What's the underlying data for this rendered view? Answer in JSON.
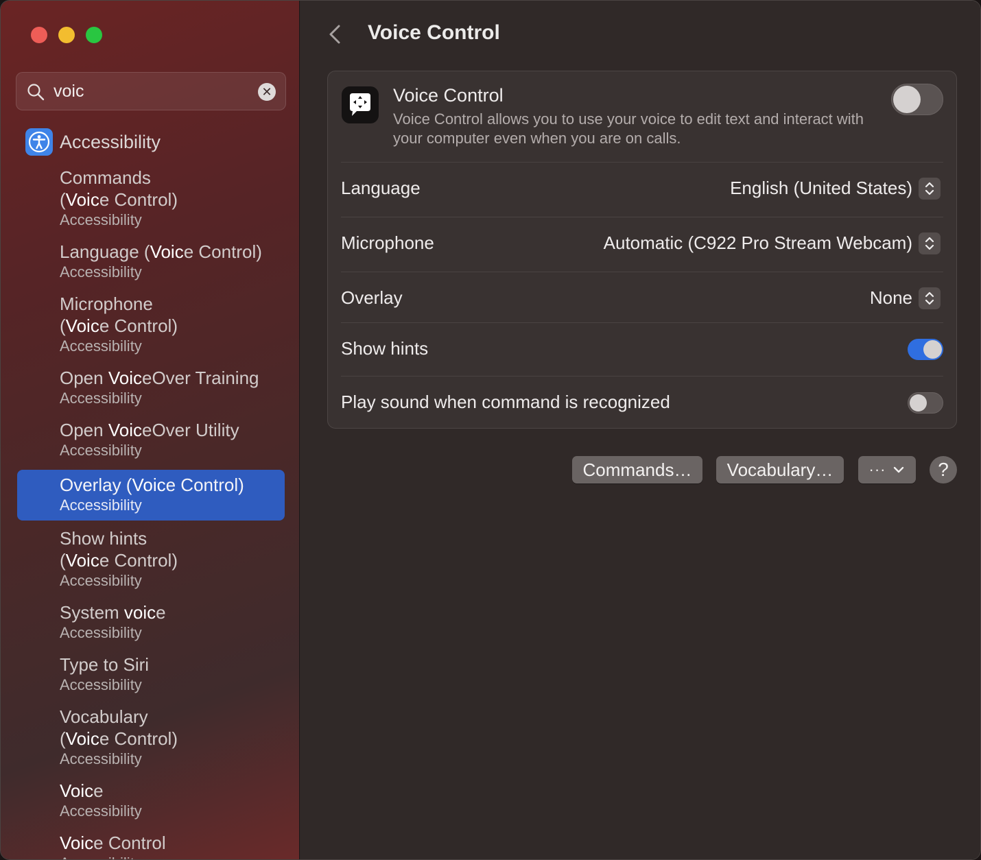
{
  "window": {
    "traffic_lights": {
      "close": "#ee5d57",
      "minimize": "#f3bd2f",
      "zoom": "#29c641"
    }
  },
  "sidebar": {
    "search": {
      "value": "voic",
      "icon": "magnifying-glass-icon",
      "clear_icon": "clear-x-icon"
    },
    "group": {
      "title": "Accessibility",
      "icon": "accessibility-icon",
      "icon_color": "#3f84e8"
    },
    "results": [
      {
        "pre": "Commands\n(",
        "hl": "Voic",
        "post": "e Control)",
        "sub": "Accessibility"
      },
      {
        "pre": "Language (",
        "hl": "Voic",
        "post": "e Control)",
        "sub": "Accessibility"
      },
      {
        "pre": "Microphone\n(",
        "hl": "Voic",
        "post": "e Control)",
        "sub": "Accessibility"
      },
      {
        "pre": "Open ",
        "hl": "Voic",
        "post": "eOver Training",
        "sub": "Accessibility"
      },
      {
        "pre": "Open ",
        "hl": "Voic",
        "post": "eOver Utility",
        "sub": "Accessibility"
      },
      {
        "pre": "Overlay (",
        "hl": "Voic",
        "post": "e Control)",
        "sub": "Accessibility",
        "selected": true
      },
      {
        "pre": "Show hints\n(",
        "hl": "Voic",
        "post": "e Control)",
        "sub": "Accessibility"
      },
      {
        "pre": "System ",
        "hl": "voic",
        "post": "e",
        "sub": "Accessibility"
      },
      {
        "pre": "Type to Siri",
        "hl": "",
        "post": "",
        "sub": "Accessibility"
      },
      {
        "pre": "Vocabulary\n(",
        "hl": "Voic",
        "post": "e Control)",
        "sub": "Accessibility"
      },
      {
        "pre": "",
        "hl": "Voic",
        "post": "e",
        "sub": "Accessibility"
      },
      {
        "pre": "",
        "hl": "Voic",
        "post": "e Control",
        "sub": "Accessibility"
      }
    ],
    "selected_color": "#2f5cbf"
  },
  "main": {
    "back_icon": "chevron-left-icon",
    "title": "Voice Control",
    "voice_control": {
      "icon": "voice-control-icon",
      "title": "Voice Control",
      "description": "Voice Control allows you to use your voice to edit text and interact with your computer even when you are on calls.",
      "enabled": false
    },
    "settings": {
      "language": {
        "label": "Language",
        "value": "English (United States)"
      },
      "microphone": {
        "label": "Microphone",
        "value": "Automatic (C922 Pro Stream Webcam)"
      },
      "overlay": {
        "label": "Overlay",
        "value": "None"
      },
      "show_hints": {
        "label": "Show hints",
        "enabled": true
      },
      "play_sound": {
        "label": "Play sound when command is recognized",
        "enabled": false
      }
    },
    "buttons": {
      "commands": "Commands…",
      "vocabulary": "Vocabulary…",
      "more": "···",
      "help": "?"
    },
    "accent_color": "#2f6ee0"
  }
}
